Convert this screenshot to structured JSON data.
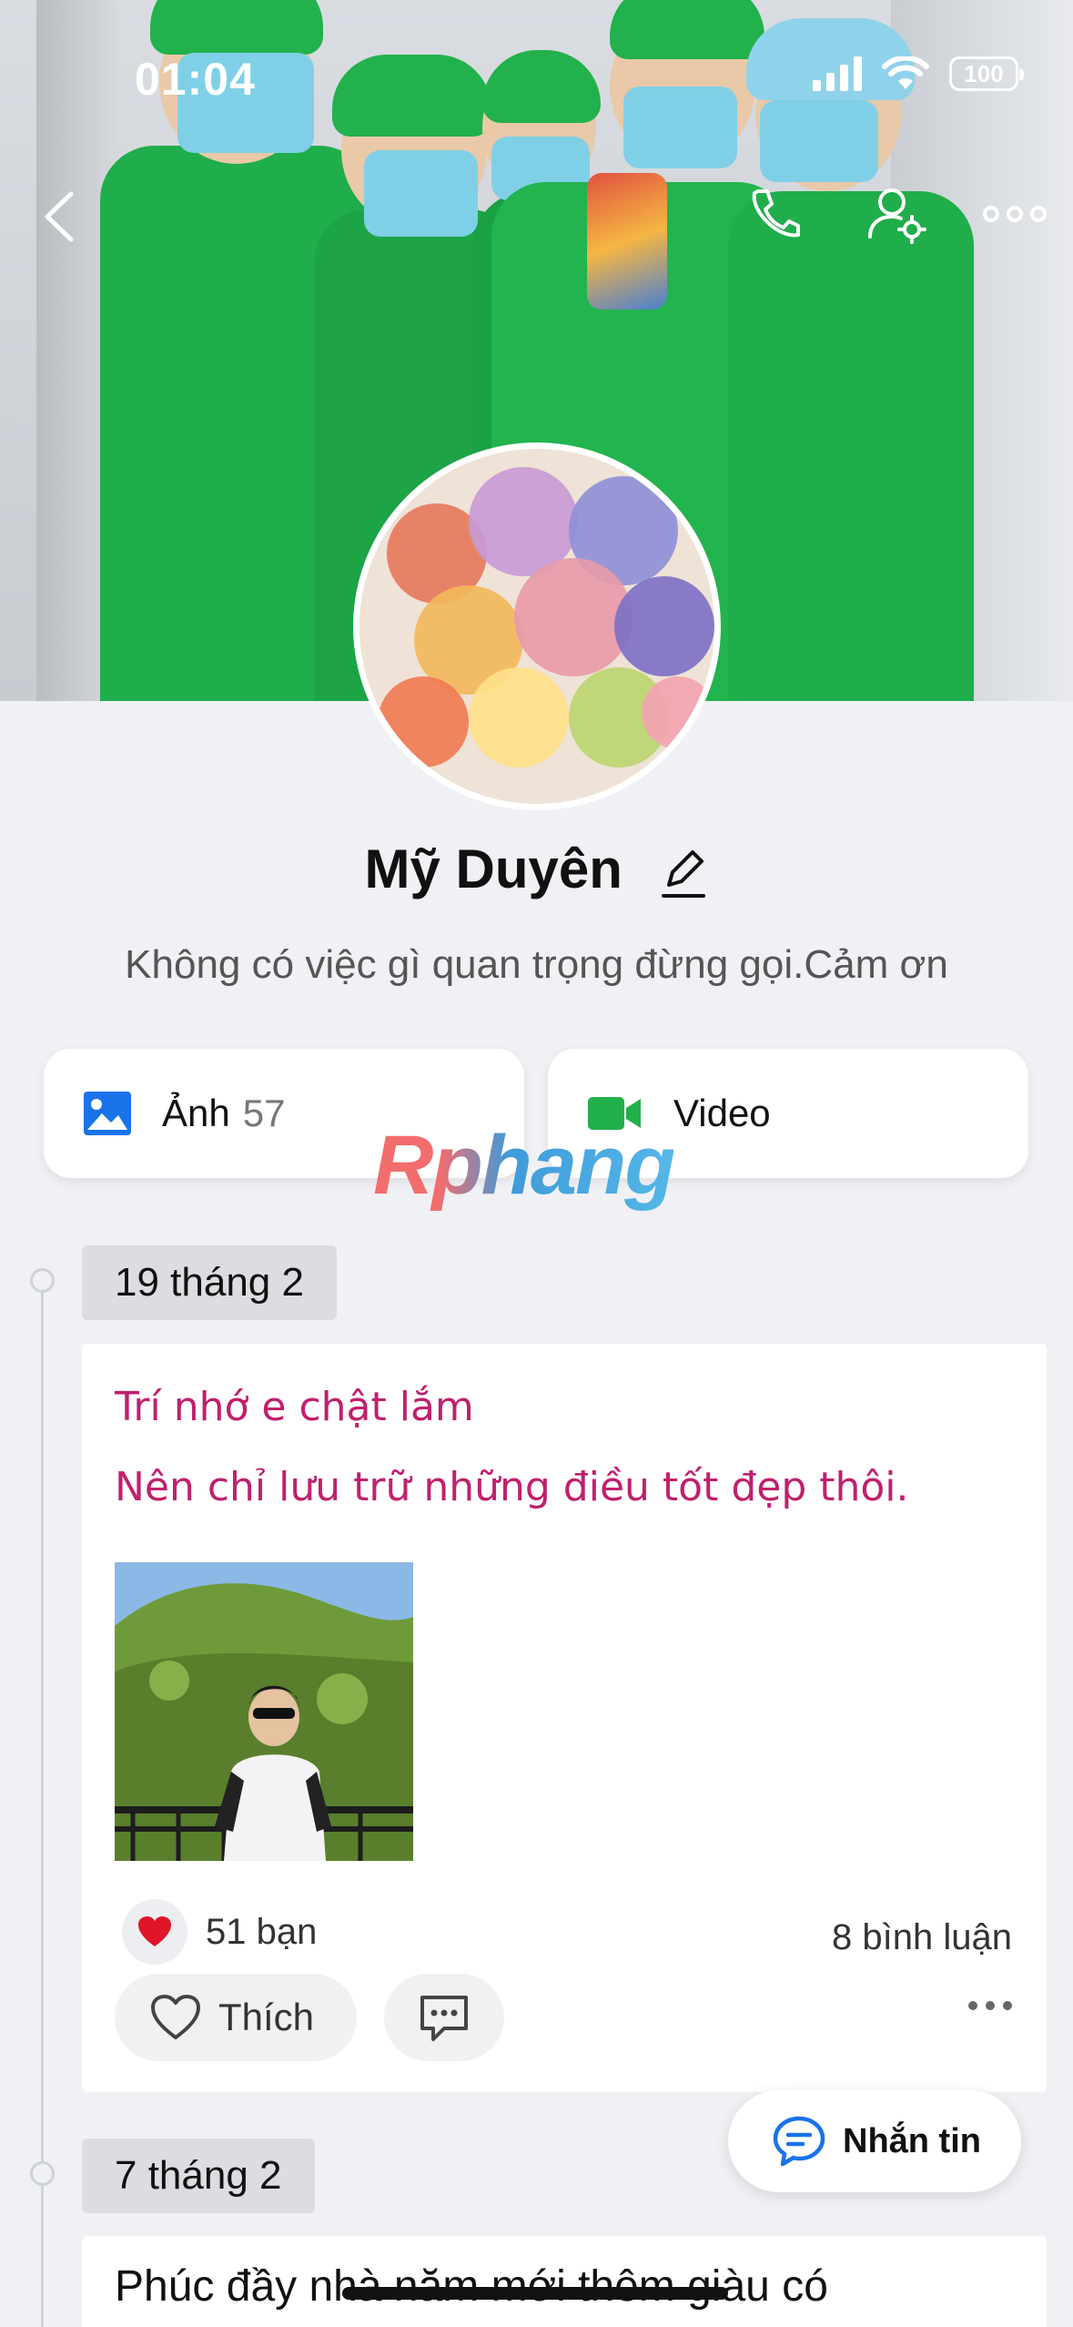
{
  "status_bar": {
    "time": "01:04",
    "battery": "100"
  },
  "profile": {
    "name": "Mỹ Duyên",
    "bio": "Không có việc gì quan trọng đừng gọi.Cảm ơn"
  },
  "media": {
    "photos_label": "Ảnh",
    "photos_count": "57",
    "video_label": "Video"
  },
  "watermark": "Rphang",
  "timeline": [
    {
      "date": "19 tháng 2",
      "lines": [
        "Trí nhớ e chật lắm",
        "Nên chỉ lưu trữ những điều tốt đẹp thôi."
      ],
      "reactions": "51 bạn",
      "comments": "8 bình luận",
      "like_label": "Thích"
    },
    {
      "date": "7 tháng 2",
      "text": "Phúc đầy nhà năm mới thêm giàu có"
    }
  ],
  "fab": {
    "label": "Nhắn tin"
  },
  "colors": {
    "post_text": "#c0206e",
    "scrubs": "#1fae4b",
    "accent_blue": "#1a73e8",
    "video_green": "#22b04b",
    "heart": "#e0152a"
  }
}
